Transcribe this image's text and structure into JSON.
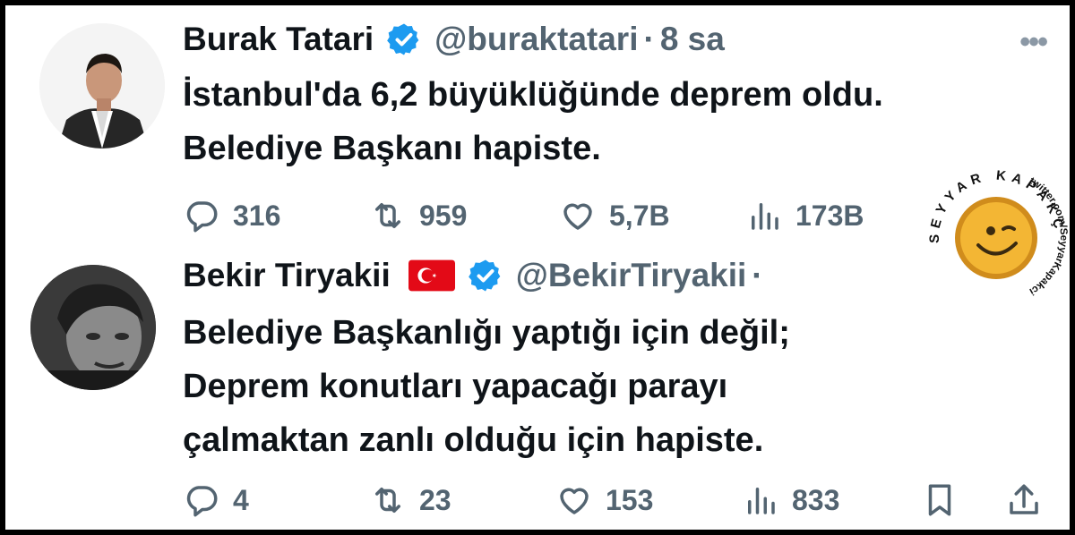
{
  "tweets": [
    {
      "author": "Burak Tatari",
      "handle": "@buraktatari",
      "separator": "·",
      "time": "8 sa",
      "more_label": "•••",
      "lines": [
        "İstanbul'da 6,2 büyüklüğünde deprem oldu.",
        "Belediye Başkanı hapiste."
      ],
      "stats": {
        "replies": "316",
        "retweets": "959",
        "likes": "5,7B",
        "views": "173B"
      }
    },
    {
      "author": "Bekir Tiryakii",
      "handle": "@BekirTiryakii",
      "separator": "·",
      "lines": [
        "Belediye Başkanlığı yaptığı için değil;",
        "Deprem konutları yapacağı parayı",
        "çalmaktan zanlı olduğu için hapiste."
      ],
      "stats": {
        "replies": "4",
        "retweets": "23",
        "likes": "153",
        "views": "833"
      }
    }
  ],
  "watermark": {
    "top_text": "SEYYAR KAPAKÇI",
    "side_text": "twitter.com/SeyyarKapakci"
  },
  "colors": {
    "text": "#0f1419",
    "muted": "#536471",
    "verified": "#1d9bf0",
    "flag_red": "#e30a17",
    "stamp_gold": "#e8a825"
  },
  "icons": [
    "reply-icon",
    "retweet-icon",
    "like-icon",
    "views-icon",
    "bookmark-icon",
    "share-icon",
    "verified-badge-icon",
    "turkey-flag-icon",
    "more-icon"
  ]
}
